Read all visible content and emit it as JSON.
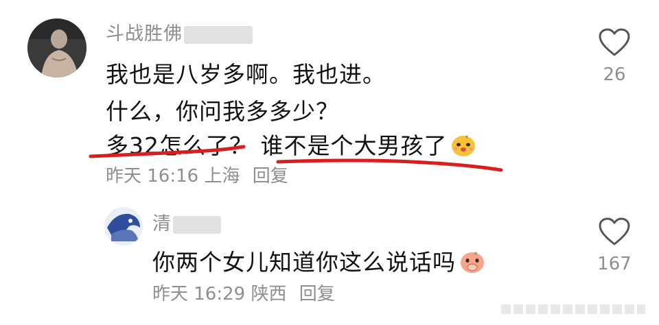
{
  "comments": [
    {
      "username": "斗战胜佛",
      "lines": [
        "我也是八岁多啊。我也进。",
        "什么，你问我多多少？",
        "多32怎么了？ 谁不是个大男孩了"
      ],
      "time": "昨天 16:16",
      "location": "上海",
      "reply_label": "回复",
      "like_count": "26",
      "emoji": "sly-face-emoji"
    },
    {
      "username": "清",
      "lines": [
        "你两个女儿知道你这么说话吗"
      ],
      "time": "昨天 16:29",
      "location": "陕西",
      "reply_label": "回复",
      "like_count": "167",
      "emoji": "covering-mouth-emoji"
    }
  ],
  "colors": {
    "annotation_red": "#d81e1e",
    "meta_gray": "#8e8e8e"
  },
  "icons": [
    "heart-outline-icon",
    "avatar-photo",
    "avatar-photo"
  ]
}
